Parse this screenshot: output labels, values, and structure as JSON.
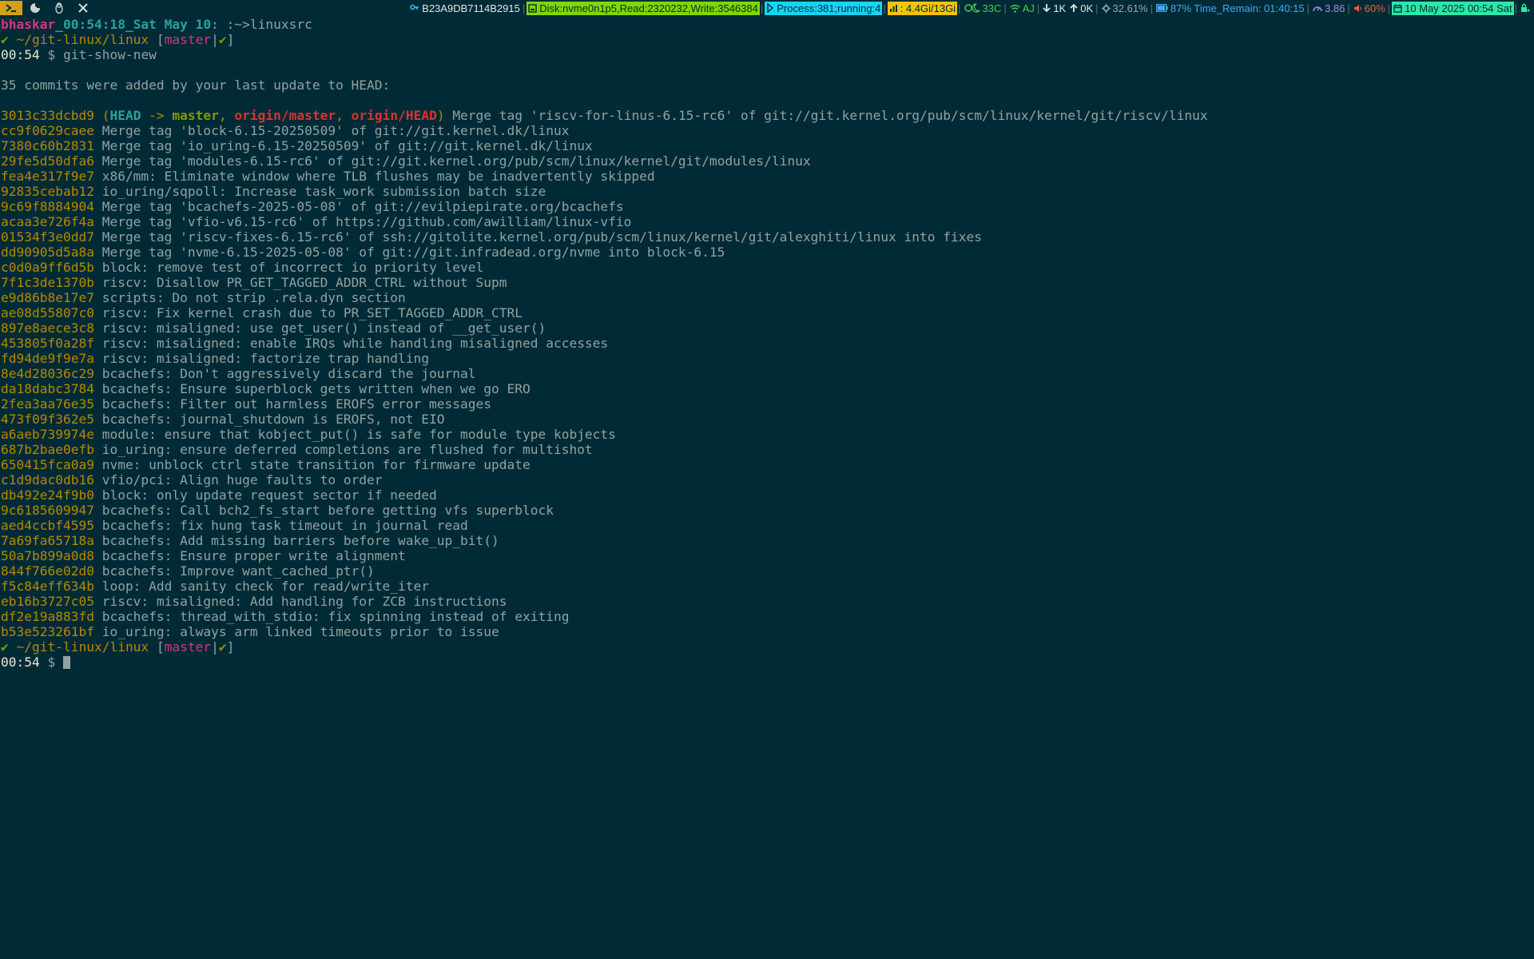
{
  "topbar": {
    "workspaces": [
      {
        "icon": "terminal-icon",
        "active": true
      },
      {
        "icon": "firefox-icon",
        "active": false
      },
      {
        "icon": "penguin-icon",
        "active": false
      },
      {
        "icon": "tools-icon",
        "active": false
      }
    ],
    "ssid": "B23A9DB7114B2915",
    "disk": "Disk:nvme0n1p5,Read:2320232,Write:3546384",
    "process": "Process:381;running:4",
    "memory": ": 4.4Gi/13Gi",
    "temp": "33C",
    "wifi": "AJ",
    "down": "1K",
    "up": "0K",
    "cpu": "32.61%",
    "battery": "87% Time_Remain: 01:40:15",
    "load": "3.86",
    "volume": "60%",
    "date": "10 May 2025 00:54 Sat"
  },
  "terminal": {
    "prompt1": {
      "user": "bhaskar",
      "host": "_00:54:18_Sat May 10:",
      "path": " :~>linuxsrc"
    },
    "prompt2": {
      "check": "✔",
      "dir": "~/git-linux/linux",
      "lbracket": "[",
      "branch": "master",
      "pipe": "|",
      "branch_ok": "✔",
      "rbracket": "]"
    },
    "cmd_time": "00:54",
    "cmd_dollar": "$",
    "command": "git-show-new",
    "summary": "35 commits were added by your last update to HEAD:",
    "first_commit": {
      "hash": "3013c33dcbd9",
      "open": "(",
      "head": "HEAD",
      "arrow": " -> ",
      "local": "master",
      "comma1": ", ",
      "remote1": "origin/master",
      "comma2": ", ",
      "remote2": "origin/HEAD",
      "close": ")",
      "msg": "Merge tag 'riscv-for-linus-6.15-rc6' of git://git.kernel.org/pub/scm/linux/kernel/git/riscv/linux"
    },
    "commits": [
      {
        "hash": "cc9f0629caee",
        "msg": "Merge tag 'block-6.15-20250509' of git://git.kernel.dk/linux"
      },
      {
        "hash": "7380c60b2831",
        "msg": "Merge tag 'io_uring-6.15-20250509' of git://git.kernel.dk/linux"
      },
      {
        "hash": "29fe5d50dfa6",
        "msg": "Merge tag 'modules-6.15-rc6' of git://git.kernel.org/pub/scm/linux/kernel/git/modules/linux"
      },
      {
        "hash": "fea4e317f9e7",
        "msg": "x86/mm: Eliminate window where TLB flushes may be inadvertently skipped"
      },
      {
        "hash": "92835cebab12",
        "msg": "io_uring/sqpoll: Increase task_work submission batch size"
      },
      {
        "hash": "9c69f8884904",
        "msg": "Merge tag 'bcachefs-2025-05-08' of git://evilpiepirate.org/bcachefs"
      },
      {
        "hash": "acaa3e726f4a",
        "msg": "Merge tag 'vfio-v6.15-rc6' of https://github.com/awilliam/linux-vfio"
      },
      {
        "hash": "01534f3e0dd7",
        "msg": "Merge tag 'riscv-fixes-6.15-rc6' of ssh://gitolite.kernel.org/pub/scm/linux/kernel/git/alexghiti/linux into fixes"
      },
      {
        "hash": "dd90905d5a8a",
        "msg": "Merge tag 'nvme-6.15-2025-05-08' of git://git.infradead.org/nvme into block-6.15"
      },
      {
        "hash": "c0d0a9ff6d5b",
        "msg": "block: remove test of incorrect io priority level"
      },
      {
        "hash": "7f1c3de1370b",
        "msg": "riscv: Disallow PR_GET_TAGGED_ADDR_CTRL without Supm"
      },
      {
        "hash": "e9d86b8e17e7",
        "msg": "scripts: Do not strip .rela.dyn section"
      },
      {
        "hash": "ae08d55807c0",
        "msg": "riscv: Fix kernel crash due to PR_SET_TAGGED_ADDR_CTRL"
      },
      {
        "hash": "897e8aece3c8",
        "msg": "riscv: misaligned: use get_user() instead of __get_user()"
      },
      {
        "hash": "453805f0a28f",
        "msg": "riscv: misaligned: enable IRQs while handling misaligned accesses"
      },
      {
        "hash": "fd94de9f9e7a",
        "msg": "riscv: misaligned: factorize trap handling"
      },
      {
        "hash": "8e4d28036c29",
        "msg": "bcachefs: Don't aggressively discard the journal"
      },
      {
        "hash": "da18dabc3784",
        "msg": "bcachefs: Ensure superblock gets written when we go ERO"
      },
      {
        "hash": "2fea3aa76e35",
        "msg": "bcachefs: Filter out harmless EROFS error messages"
      },
      {
        "hash": "473f09f362e5",
        "msg": "bcachefs: journal_shutdown is EROFS, not EIO"
      },
      {
        "hash": "a6aeb739974e",
        "msg": "module: ensure that kobject_put() is safe for module type kobjects"
      },
      {
        "hash": "687b2bae0efb",
        "msg": "io_uring: ensure deferred completions are flushed for multishot"
      },
      {
        "hash": "650415fca0a9",
        "msg": "nvme: unblock ctrl state transition for firmware update"
      },
      {
        "hash": "c1d9dac0db16",
        "msg": "vfio/pci: Align huge faults to order"
      },
      {
        "hash": "db492e24f9b0",
        "msg": "block: only update request sector if needed"
      },
      {
        "hash": "9c6185609947",
        "msg": "bcachefs: Call bch2_fs_start before getting vfs superblock"
      },
      {
        "hash": "aed4ccbf4595",
        "msg": "bcachefs: fix hung task timeout in journal read"
      },
      {
        "hash": "7a69fa65718a",
        "msg": "bcachefs: Add missing barriers before wake_up_bit()"
      },
      {
        "hash": "50a7b899a0d8",
        "msg": "bcachefs: Ensure proper write alignment"
      },
      {
        "hash": "844f766e02d0",
        "msg": "bcachefs: Improve want_cached_ptr()"
      },
      {
        "hash": "f5c84eff634b",
        "msg": "loop: Add sanity check for read/write_iter"
      },
      {
        "hash": "eb16b3727c05",
        "msg": "riscv: misaligned: Add handling for ZCB instructions"
      },
      {
        "hash": "df2e19a883fd",
        "msg": "bcachefs: thread_with_stdio: fix spinning instead of exiting"
      },
      {
        "hash": "b53e523261bf",
        "msg": "io_uring: always arm linked timeouts prior to issue"
      }
    ],
    "final_time": "00:54",
    "final_dollar": "$"
  },
  "colors": {
    "background": "#002b36",
    "foreground": "#93a1a1",
    "hash": "#b58900",
    "branch": "#d33682"
  }
}
